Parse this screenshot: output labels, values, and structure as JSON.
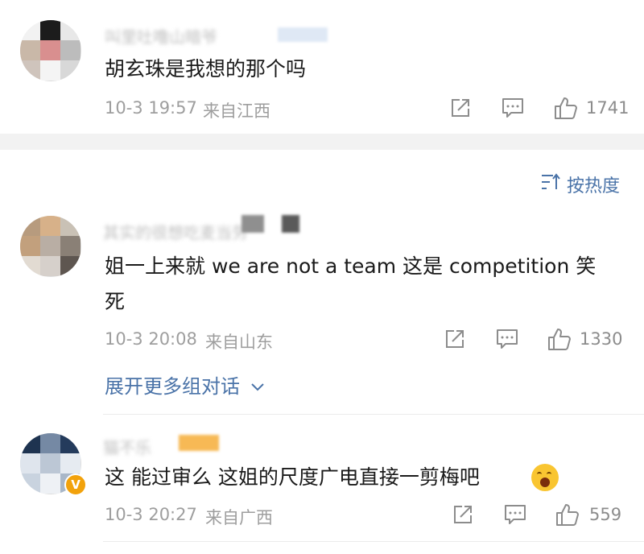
{
  "comments": [
    {
      "username": "叫里吐噜山暗爷",
      "text": "胡玄珠是我想的那个吗",
      "date": "10-3 19:57",
      "location": "来自江西",
      "likes": "1741"
    },
    {
      "username": "其实的很想吃麦当劳",
      "text_line1": "姐一上来就 we are not a team 这是 competition 笑",
      "text_line2": "死",
      "date": "10-3 20:08",
      "location": "来自山东",
      "likes": "1330",
      "expand_label": "展开更多组对话"
    },
    {
      "username": "猫不乐",
      "text": "这 能过审么 这姐的尺度广电直接一剪梅吧",
      "date": "10-3 20:27",
      "location": "来自广西",
      "likes": "559"
    }
  ],
  "sort_label": "按热度",
  "icons": [
    "share-icon",
    "comment-icon",
    "like-icon",
    "sort-icon",
    "chevron-down-icon",
    "verified-icon",
    "emoji-icon"
  ],
  "colors": {
    "link": "#4a73a8",
    "meta": "#9e9e9e",
    "badge": "#f2a20c",
    "separator": "#f2f2f2"
  }
}
